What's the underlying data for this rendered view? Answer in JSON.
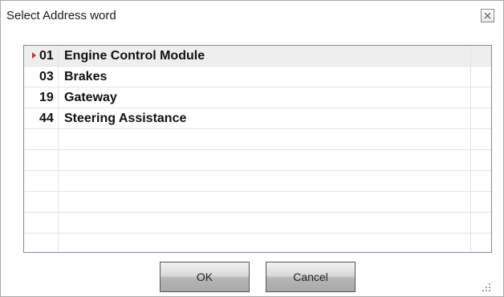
{
  "window": {
    "title": "Select Address word",
    "close_icon": "close-icon"
  },
  "list": {
    "selected_index": 0,
    "rows": [
      {
        "code": "01",
        "name": "Engine Control Module"
      },
      {
        "code": "03",
        "name": "Brakes"
      },
      {
        "code": "19",
        "name": "Gateway"
      },
      {
        "code": "44",
        "name": "Steering Assistance"
      }
    ],
    "empty_row_count": 6
  },
  "buttons": {
    "ok_label": "OK",
    "cancel_label": "Cancel"
  },
  "colors": {
    "selection_arrow": "#c0392b",
    "selected_row_bg": "#eeeeee"
  }
}
